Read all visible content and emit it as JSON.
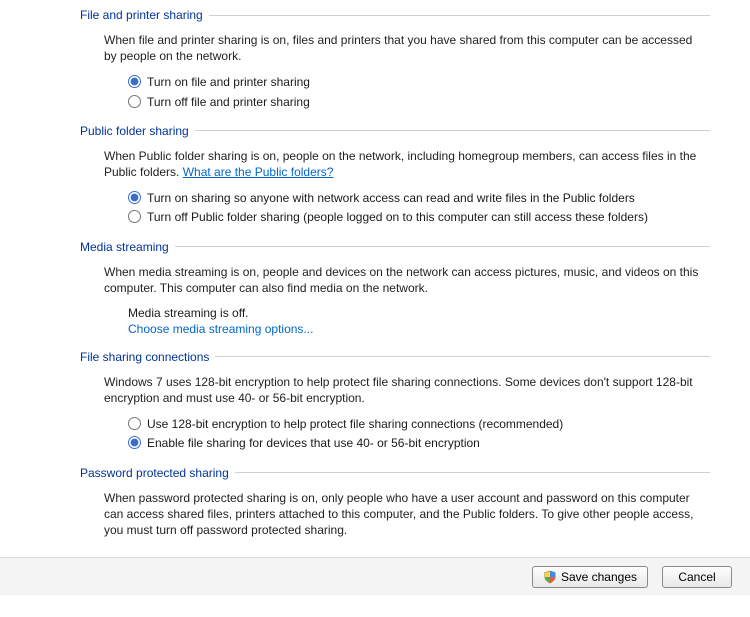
{
  "sections": {
    "file_printer": {
      "title": "File and printer sharing",
      "desc": "When file and printer sharing is on, files and printers that you have shared from this computer can be accessed by people on the network.",
      "opt_on": "Turn on file and printer sharing",
      "opt_off": "Turn off file and printer sharing"
    },
    "public_folder": {
      "title": "Public folder sharing",
      "desc_prefix": "When Public folder sharing is on, people on the network, including homegroup members, can access files in the Public folders. ",
      "desc_link": "What are the Public folders?",
      "opt_on": "Turn on sharing so anyone with network access can read and write files in the Public folders",
      "opt_off": "Turn off Public folder sharing (people logged on to this computer can still access these folders)"
    },
    "media": {
      "title": "Media streaming",
      "desc": "When media streaming is on, people and devices on the network can access pictures, music, and videos on this computer. This computer can also find media on the network.",
      "status": "Media streaming is off.",
      "link": "Choose media streaming options..."
    },
    "connections": {
      "title": "File sharing connections",
      "desc": "Windows 7 uses 128-bit encryption to help protect file sharing connections. Some devices don't support 128-bit encryption and must use 40- or 56-bit encryption.",
      "opt_128": "Use 128-bit encryption to help protect file sharing connections (recommended)",
      "opt_4056": "Enable file sharing for devices that use 40- or 56-bit encryption"
    },
    "password": {
      "title": "Password protected sharing",
      "desc": "When password protected sharing is on, only people who have a user account and password on this computer can access shared files, printers attached to this computer, and the Public folders. To give other people access, you must turn off password protected sharing."
    }
  },
  "footer": {
    "save": "Save changes",
    "cancel": "Cancel"
  }
}
